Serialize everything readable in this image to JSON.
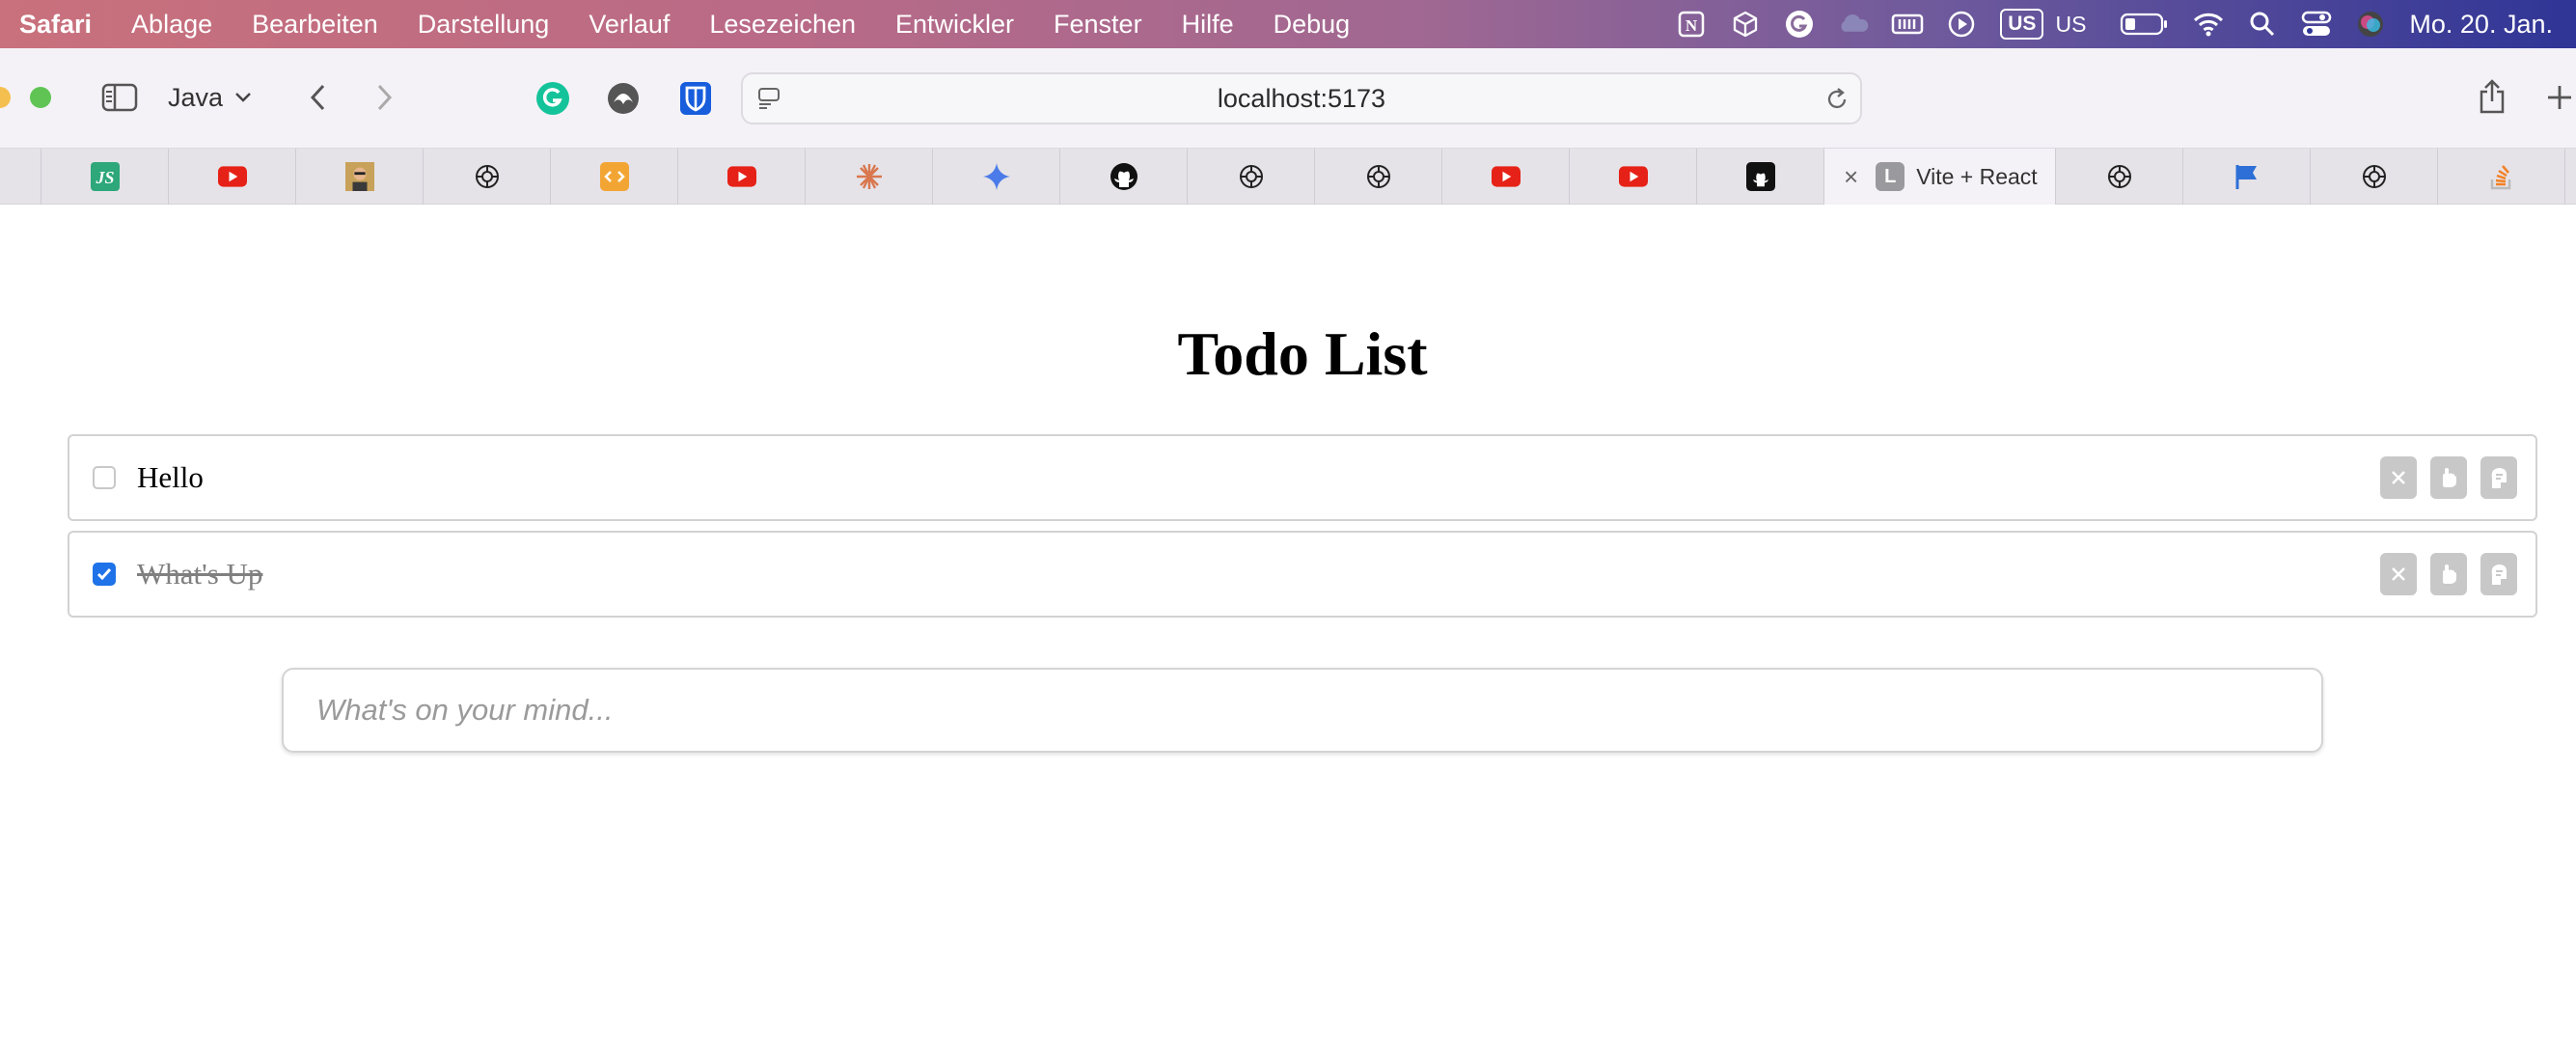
{
  "menubar": {
    "app": "Safari",
    "items": [
      "Ablage",
      "Bearbeiten",
      "Darstellung",
      "Verlauf",
      "Lesezeichen",
      "Entwickler",
      "Fenster",
      "Hilfe",
      "Debug"
    ],
    "keyboard_box": "US",
    "keyboard_label": "US",
    "clock": "Mo. 20. Jan."
  },
  "toolbar": {
    "profile_label": "Java",
    "url": "localhost:5173"
  },
  "tabs": {
    "active_title": "Vite + React",
    "active_favicon_letter": "L"
  },
  "page": {
    "title": "Todo List",
    "todos": [
      {
        "text": "Hello",
        "done": false
      },
      {
        "text": "What's Up",
        "done": true
      }
    ],
    "input_placeholder": "What's on your mind..."
  },
  "colors": {
    "checkbox_checked": "#1f72e8",
    "action_button": "#c8c8c8"
  }
}
